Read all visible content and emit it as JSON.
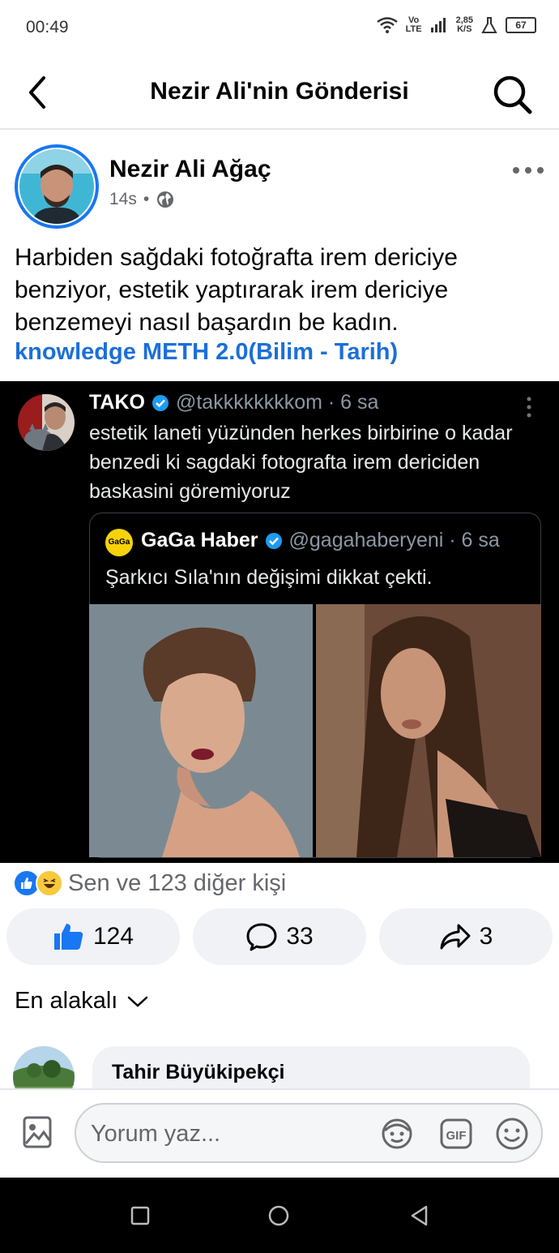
{
  "status_bar": {
    "time": "00:49",
    "network_top": "Vo",
    "network_bottom": "LTE",
    "speed_top": "2,85",
    "speed_bottom": "K/S",
    "battery": "67"
  },
  "header": {
    "title": "Nezir Ali'nin Gönderisi"
  },
  "post": {
    "author": "Nezir Ali Ağaç",
    "time": "14s",
    "separator": "•",
    "text": "Harbiden sağdaki fotoğrafta irem dericiye benziyor, estetik yaptırarak irem dericiye benzemeyi nasıl başardın be kadın.",
    "group": "knowledge METH 2.0(Bilim - Tarih)"
  },
  "tweet": {
    "name": "TAKO",
    "handle": "@takkkkkkkkom · 6 sa",
    "text": "estetik laneti yüzünden herkes birbirine o kadar benzedi ki sagdaki fotografta irem dericiden baskasini göremiyoruz",
    "quote": {
      "logo_text": "GaGa",
      "name": "GaGa Haber",
      "handle": "@gagahaberyeni · 6 sa",
      "text": "Şarkıcı Sıla'nın değişimi dikkat çekti."
    }
  },
  "reactions": {
    "summary": "Sen ve 123 diğer kişi"
  },
  "actions": {
    "likes": "124",
    "comments": "33",
    "shares": "3"
  },
  "sort": {
    "label": "En alakalı"
  },
  "comments": [
    {
      "author": "Tahir Büyükipekçi"
    }
  ],
  "composer": {
    "placeholder": "Yorum yaz...",
    "gif_label": "GIF"
  },
  "colors": {
    "accent": "#1877f2",
    "link": "#1b6fd8",
    "tweet_bg": "#000000",
    "muted": "#65676b"
  }
}
